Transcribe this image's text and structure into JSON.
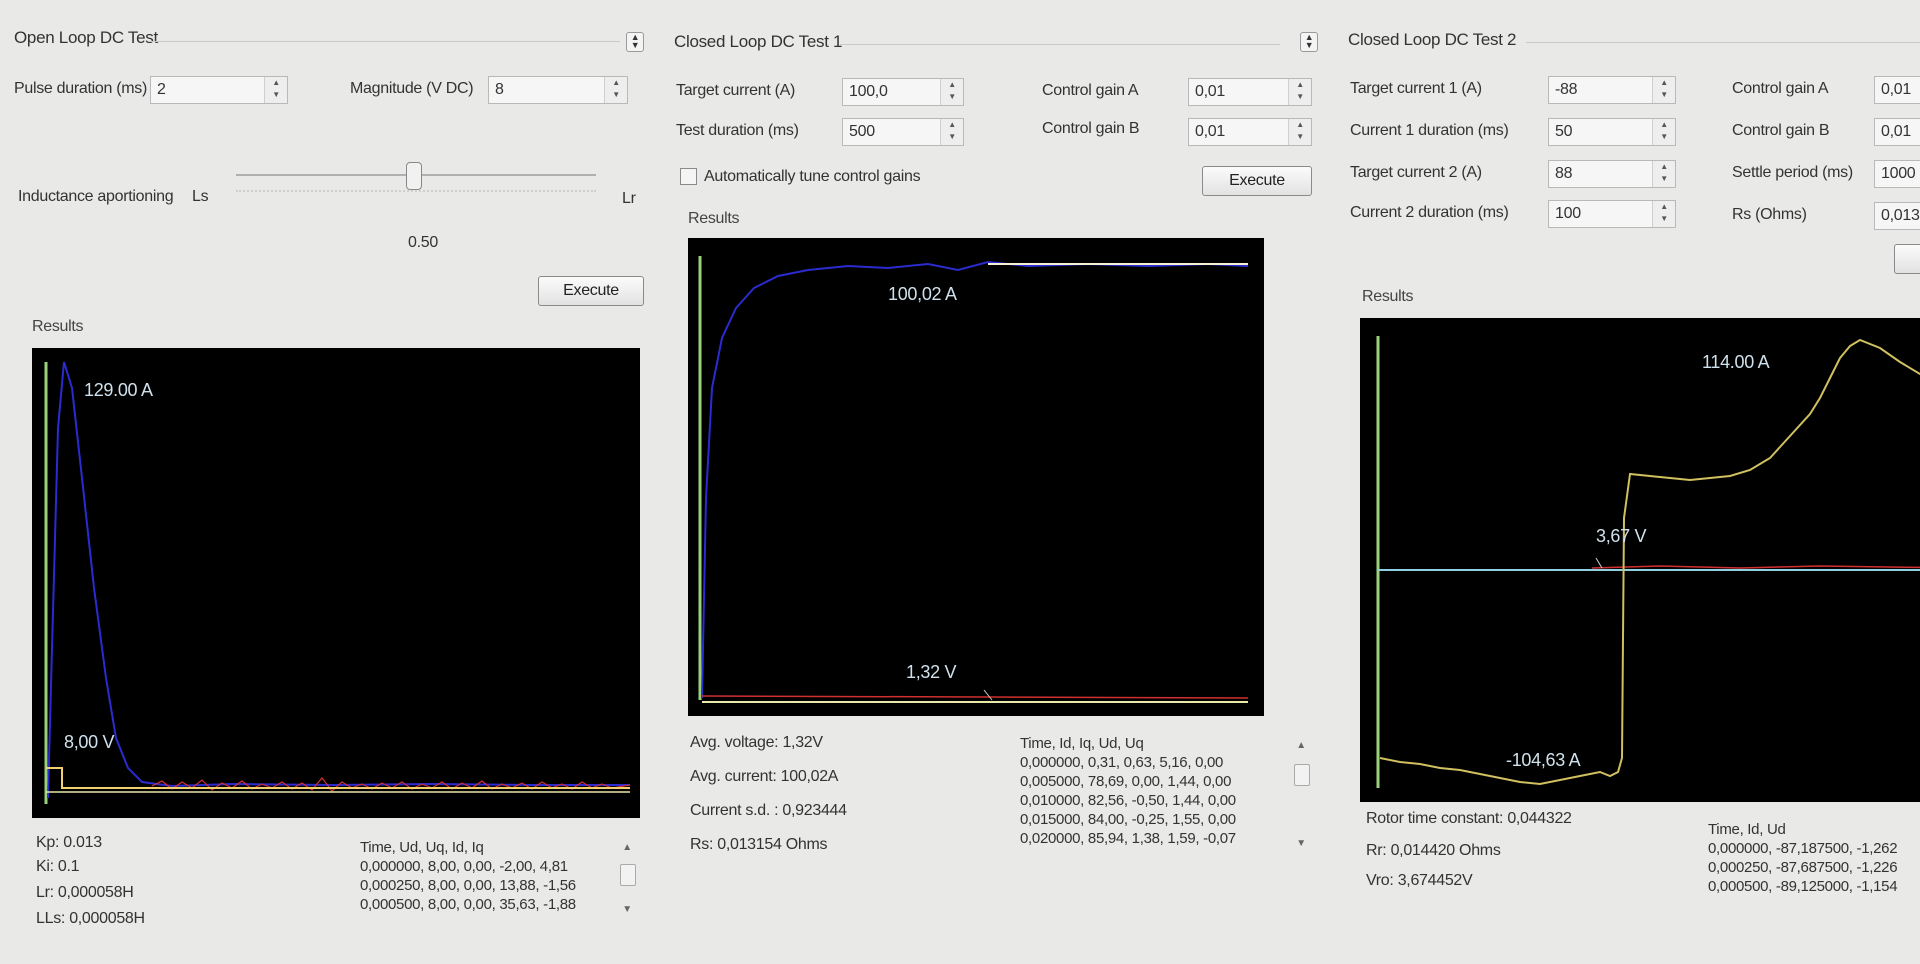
{
  "panel1": {
    "title": "Open Loop DC Test",
    "pulse_label": "Pulse duration (ms)",
    "pulse_value": "2",
    "magnitude_label": "Magnitude (V DC)",
    "magnitude_value": "8",
    "inductance_label": "Inductance aportioning",
    "ls_label": "Ls",
    "lr_label": "Lr",
    "slider_value": "0.50",
    "slider_fraction": 0.5,
    "execute_label": "Execute",
    "results_label": "Results",
    "plot_current_label": "129.00 A",
    "plot_voltage_label": "8,00 V",
    "stats": [
      "Kp: 0.013",
      "Ki: 0.1",
      "Lr: 0,000058H",
      "LLs: 0,000058H"
    ],
    "list_header": "Time, Ud, Uq, Id, Iq",
    "list_rows": [
      "0,000000, 8,00, 0,00, -2,00, 4,81",
      "0,000250, 8,00, 0,00, 13,88, -1,56",
      "0,000500, 8,00, 0,00, 35,63, -1,88"
    ]
  },
  "panel2": {
    "title": "Closed Loop DC Test 1",
    "target_label": "Target current (A)",
    "target_value": "100,0",
    "duration_label": "Test duration (ms)",
    "duration_value": "500",
    "gain_a_label": "Control gain A",
    "gain_a_value": "0,01",
    "gain_b_label": "Control gain B",
    "gain_b_value": "0,01",
    "auto_tune_label": "Automatically tune control gains",
    "execute_label": "Execute",
    "results_label": "Results",
    "plot_current_label": "100,02 A",
    "plot_voltage_label": "1,32 V",
    "stats": [
      "Avg. voltage: 1,32V",
      "Avg. current: 100,02A",
      "Current s.d. : 0,923444",
      "Rs: 0,013154 Ohms"
    ],
    "list_header": "Time, Id, Iq, Ud, Uq",
    "list_rows": [
      "0,000000, 0,31, 0,63, 5,16, 0,00",
      "0,005000, 78,69, 0,00, 1,44, 0,00",
      "0,010000, 82,56, -0,50, 1,44, 0,00",
      "0,015000, 84,00, -0,25, 1,55, 0,00",
      "0,020000, 85,94, 1,38, 1,59, -0,07"
    ]
  },
  "panel3": {
    "title": "Closed Loop DC Test 2",
    "target1_label": "Target current 1 (A)",
    "target1_value": "-88",
    "dur1_label": "Current 1 duration (ms)",
    "dur1_value": "50",
    "target2_label": "Target current 2 (A)",
    "target2_value": "88",
    "dur2_label": "Current 2 duration (ms)",
    "dur2_value": "100",
    "gain_a_label": "Control gain A",
    "gain_a_value": "0,01",
    "gain_b_label": "Control gain B",
    "gain_b_value": "0,01",
    "settle_label": "Settle period (ms)",
    "settle_value": "1000",
    "rs_label": "Rs (Ohms)",
    "rs_value": "0,013",
    "results_label": "Results",
    "plot_pos_label": "114.00 A",
    "plot_voltage_label": "3,67 V",
    "plot_neg_label": "-104,63 A",
    "stats": [
      "Rotor time constant: 0,044322",
      "Rr: 0,014420 Ohms",
      "Vro: 3,674452V"
    ],
    "list_header": "Time, Id, Ud",
    "list_rows": [
      "0,000000, -87,187500, -1,262",
      "0,000250, -87,687500, -1,226",
      "0,000500, -89,125000, -1,154"
    ]
  },
  "colors": {
    "plot_bg": "#000000",
    "current_trace": "#2b2bd0",
    "voltage_trace": "#e8e8a8",
    "reference_trace": "#f0d070",
    "noise_trace": "#d03030",
    "axis_trace": "#9ad27a"
  }
}
